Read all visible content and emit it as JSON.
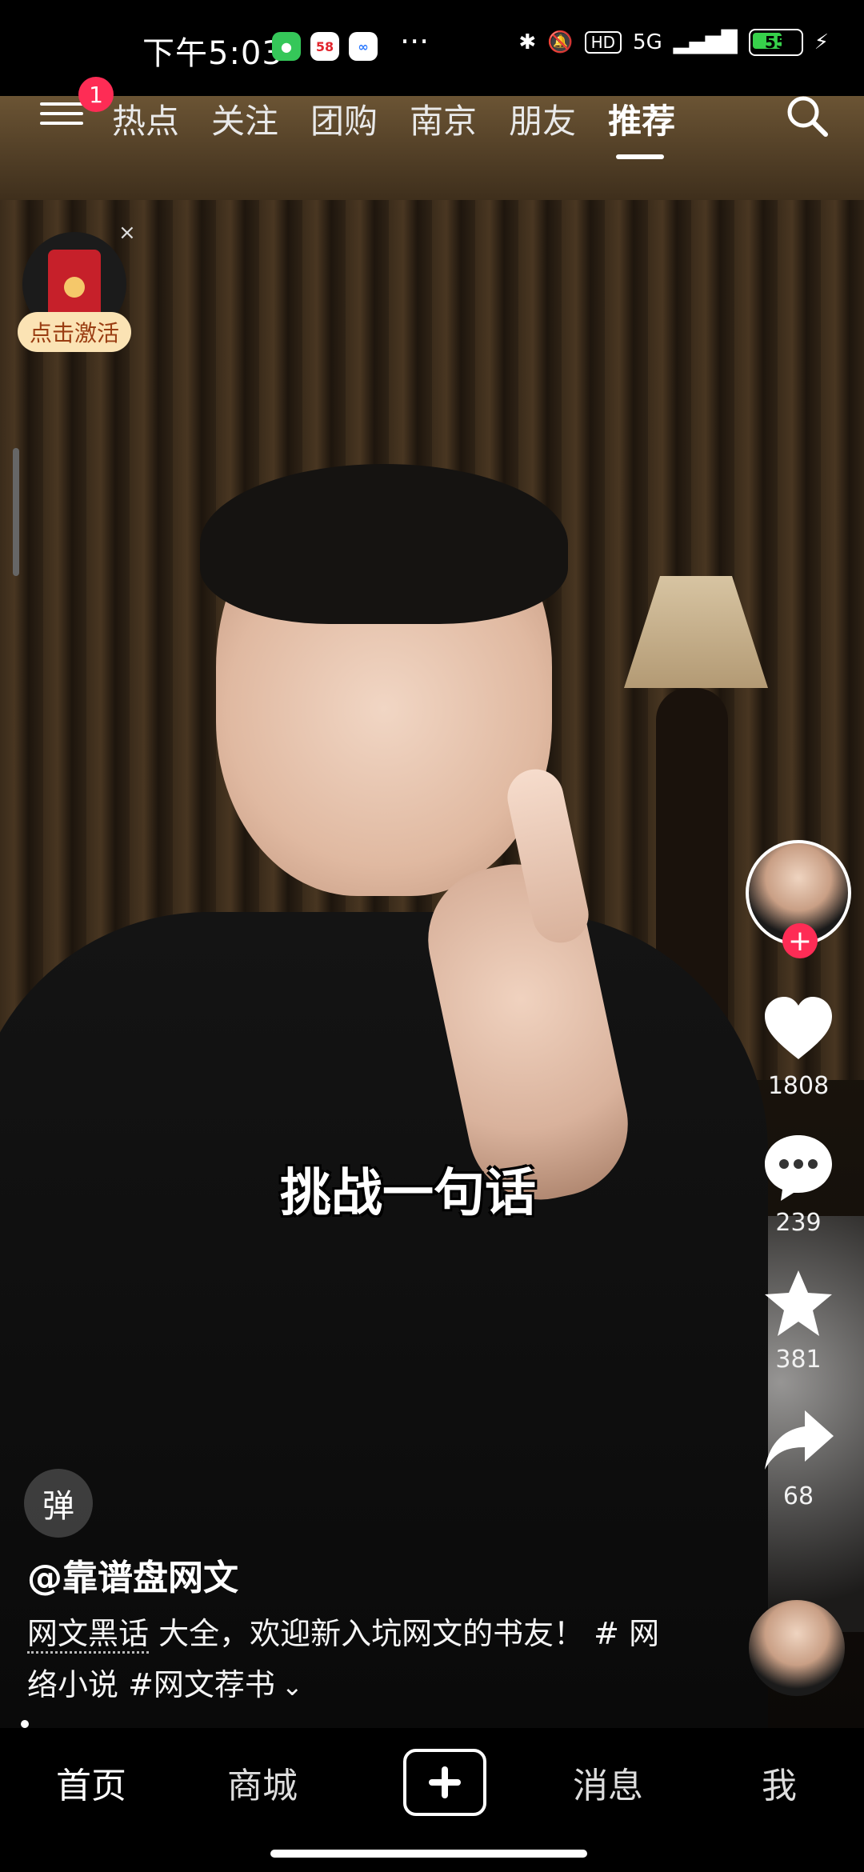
{
  "status_bar": {
    "time": "下午5:03",
    "more": "···",
    "hd": "HD",
    "network": "5G",
    "battery": "55"
  },
  "top_nav": {
    "badge": "1",
    "tabs": [
      "热点",
      "关注",
      "团购",
      "南京",
      "朋友",
      "推荐"
    ],
    "active_tab": "推荐"
  },
  "promo": {
    "activate_label": "点击激活",
    "close": "×"
  },
  "video": {
    "subtitle": "挑战一句话",
    "author": "@靠谱盘网文",
    "description_highlight": "网文黑话",
    "description_rest": " 大全，欢迎新入坑网文的书友！ # 网络小说  #网文荐书"
  },
  "rail": {
    "likes": "1808",
    "comments": "239",
    "favorites": "381",
    "shares": "68",
    "follow": "+"
  },
  "danmu": "弹",
  "bottom_nav": {
    "home": "首页",
    "mall": "商城",
    "messages": "消息",
    "me": "我"
  },
  "colors": {
    "accent": "#fe2c55",
    "promo_bg": "#fbe3b4",
    "promo_text": "#9a3d12"
  }
}
